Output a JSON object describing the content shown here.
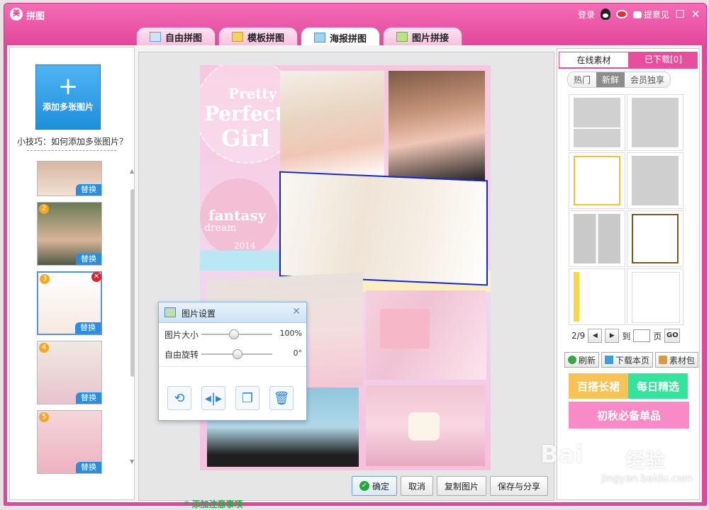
{
  "window": {
    "title": "拼图",
    "app_icon": "美"
  },
  "titlebar": {
    "login": "登录",
    "feedback": "提意见"
  },
  "tabs": [
    {
      "label": "自由拼图",
      "icon": "free-collage-icon",
      "active": false
    },
    {
      "label": "模板拼图",
      "icon": "template-collage-icon",
      "active": false
    },
    {
      "label": "海报拼图",
      "icon": "poster-collage-icon",
      "active": true
    },
    {
      "label": "图片拼接",
      "icon": "image-join-icon",
      "active": false
    }
  ],
  "left": {
    "add_button": "添加多张图片",
    "tip": "小技巧：如何添加多张图片？",
    "thumbs": [
      {
        "num": "",
        "replace": "替换"
      },
      {
        "num": "2",
        "replace": "替换"
      },
      {
        "num": "3",
        "replace": "替换",
        "selected": true
      },
      {
        "num": "4",
        "replace": "替换"
      },
      {
        "num": "5",
        "replace": "替换"
      }
    ]
  },
  "poster": {
    "text_pretty": "Pretty",
    "text_perfect": "Perfect",
    "text_girl": "Girl",
    "text_fantasy": "fantasy",
    "text_dream": "dream",
    "text_year": "2014"
  },
  "dialog": {
    "title": "图片设置",
    "size_label": "图片大小",
    "size_value": "100%",
    "size_level": 0.45,
    "rotate_label": "自由旋转",
    "rotate_value": "0°",
    "rotate_level": 0.5
  },
  "bottom": {
    "ok": "确定",
    "cancel": "取消",
    "copy": "复制图片",
    "save": "保存与分享"
  },
  "right": {
    "tab_online": "在线素材",
    "tab_downloaded": "已下载[0]",
    "filters": [
      "热门",
      "新鲜",
      "会员独享"
    ],
    "pager_page": "2/9",
    "pager_to": "到",
    "pager_unit": "页",
    "pager_go": "GO",
    "refresh": "刷新",
    "download_page": "下载本页",
    "material_pack": "素材包",
    "banner1": "百搭长裙",
    "banner2": "每日精选",
    "banner3": "初秋必备单品"
  },
  "watermark": {
    "brand": "Bai",
    "brand2": "经验",
    "url": "jingyan.baidu.com"
  },
  "footer_text": "* 添加注意事项"
}
